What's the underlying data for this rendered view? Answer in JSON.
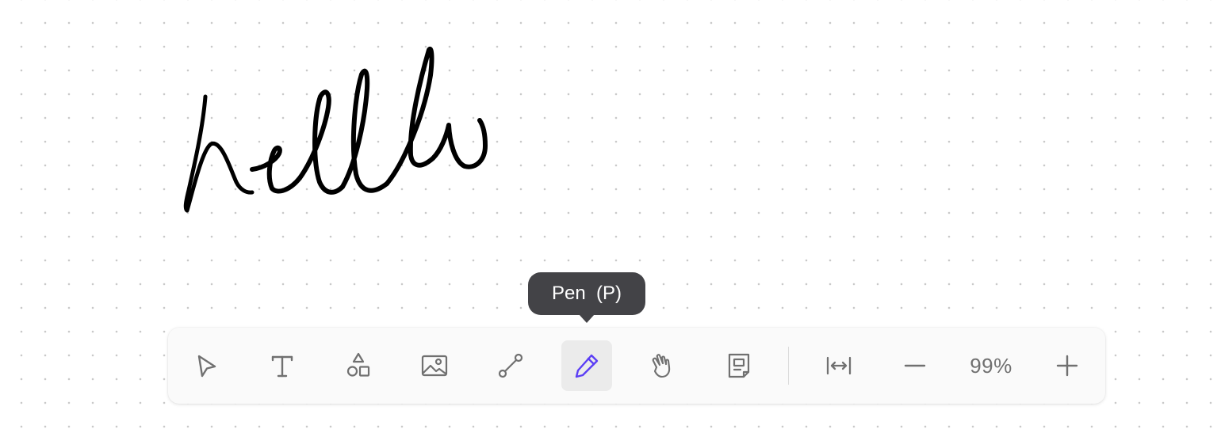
{
  "canvas": {
    "background": "#ffffff",
    "grid_dot_color": "#c9c9c9",
    "ink_color": "#000000"
  },
  "toolbar": {
    "tools": [
      {
        "id": "select",
        "icon": "pointer-icon"
      },
      {
        "id": "text",
        "icon": "text-icon"
      },
      {
        "id": "shapes",
        "icon": "shapes-icon"
      },
      {
        "id": "image",
        "icon": "image-icon"
      },
      {
        "id": "connector",
        "icon": "connector-icon"
      },
      {
        "id": "pen",
        "icon": "pen-icon",
        "active": true
      },
      {
        "id": "hand",
        "icon": "hand-icon"
      },
      {
        "id": "note",
        "icon": "note-icon"
      },
      {
        "id": "fit-width",
        "icon": "fit-width-icon"
      },
      {
        "id": "zoom-out",
        "icon": "minus-icon"
      },
      {
        "id": "zoom-in",
        "icon": "plus-icon"
      }
    ],
    "zoom_level": "99%",
    "icon_color": "#707070",
    "active_icon_color": "#5b3ef5"
  },
  "tooltip": {
    "text": "Pen  (P)",
    "background": "#434347"
  }
}
